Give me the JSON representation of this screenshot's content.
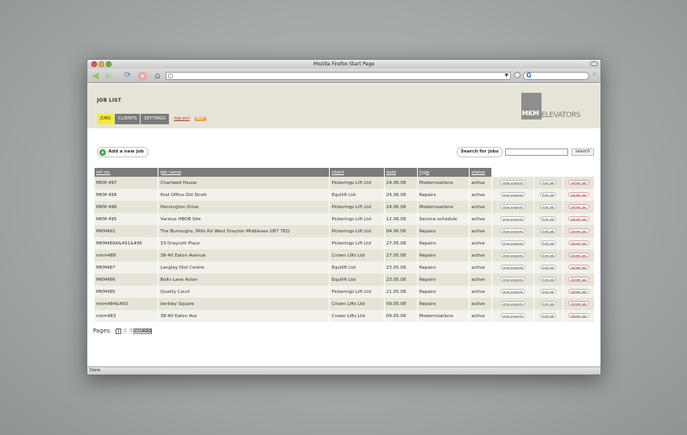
{
  "window": {
    "title": "Mozilla Firefox Start Page"
  },
  "status_bar": {
    "text": "Done"
  },
  "header": {
    "page_title": "JOB LIST",
    "tabs": [
      "JOBS",
      "CLIENTS",
      "SETTINGS"
    ],
    "logout": "log-out",
    "help": "HELP",
    "logo_mkm": "MKM",
    "logo_text": "ELEVATORS"
  },
  "actions": {
    "add_job": "Add a new job",
    "search_label": "Search for jobs",
    "search_value": "",
    "search_button": "search"
  },
  "table": {
    "headers": [
      "ref no.",
      "job name",
      "client",
      "date",
      "type",
      "status"
    ],
    "row_buttons": {
      "view": "View projects",
      "edit": "Edit job",
      "delete": "Delete job"
    },
    "rows": [
      [
        "MKM 497",
        "Chartwell House",
        "Pickerings Lift Ltd",
        "24.06.08",
        "Modernisations",
        "active"
      ],
      [
        "MKM 499",
        "Post Office Old Strett",
        "Equilift Ltd",
        "24.06.08",
        "Repairs",
        "active"
      ],
      [
        "MKM 498",
        "Pennington Drive",
        "Pickerings Lift Ltd",
        "24.06.08",
        "Modernisations",
        "active"
      ],
      [
        "MKM 495",
        "Various HBOB Site",
        "Pickerings Lift Ltd",
        "12.06.08",
        "Service schedule",
        "active"
      ],
      [
        "MKM492",
        "The Burroughs, Mills Rd West Drayton Middlesex UB7 7EQ",
        "Pickerings Lift Ltd",
        "04.06.08",
        "Repairs",
        "active"
      ],
      [
        "MKM489A&491&496",
        "33 Draycott Place",
        "Pickerings Lift Ltd",
        "27.05.08",
        "Repairs",
        "active"
      ],
      [
        "mkm488",
        "38-40 Eaton Avenue",
        "Crown Lifts Ltd",
        "27.05.08",
        "Repairs",
        "active"
      ],
      [
        "MKM487",
        "Langley Dist Centre",
        "Equilift Ltd",
        "23.05.08",
        "Repairs",
        "active"
      ],
      [
        "MKM486",
        "Bolts Lane Acton",
        "Equilift Ltd",
        "23.05.08",
        "Repairs",
        "active"
      ],
      [
        "MKM485",
        "Quality Court",
        "Pickerings Lift Ltd",
        "21.05.08",
        "Repairs",
        "active"
      ],
      [
        "mkm484&493",
        "berkley Square",
        "Crown Lifts Ltd",
        "09.05.08",
        "Repairs",
        "active"
      ],
      [
        "mkm483",
        "38-40 Eaton Ave",
        "Crown Lifts Ltd",
        "09.05.08",
        "Modernisations",
        "active"
      ]
    ]
  },
  "pagination": {
    "label": "Pages:",
    "pages": [
      "1",
      "2",
      "3"
    ],
    "next": "next >>"
  },
  "icons": {
    "back": "back-arrow-icon",
    "forward": "forward-arrow-icon",
    "reload": "reload-icon",
    "stop": "stop-icon",
    "home": "home-icon",
    "add": "plus-circle-icon"
  }
}
